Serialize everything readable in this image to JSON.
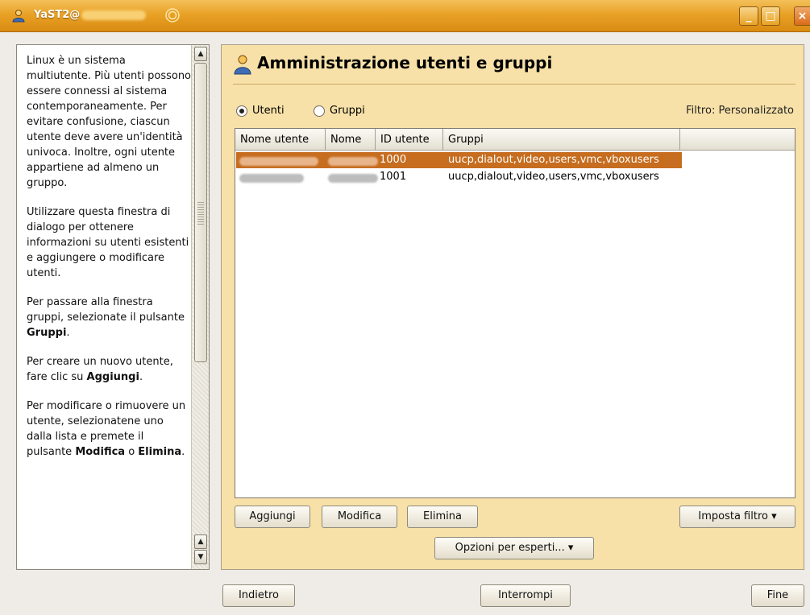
{
  "window": {
    "title": "YaST2@",
    "accent": "#e9a226",
    "minimize": "_",
    "maximize": "□",
    "close": "×"
  },
  "help": {
    "paragraphs": [
      {
        "text": "Linux è un sistema multiutente. Più utenti possono essere connessi al sistema contemporaneamente. Per evitare confusione, ciascun utente deve avere un'identità univoca. Inoltre, ogni utente appartiene ad almeno un gruppo."
      },
      {
        "text": "Utilizzare questa finestra di dialogo per ottenere informazioni su utenti esistenti e aggiungere o modificare utenti."
      },
      {
        "pre": "Per passare alla finestra gruppi, selezionate il pulsante ",
        "bold": "Gruppi",
        "post": "."
      },
      {
        "pre": "Per creare un nuovo utente, fare clic su ",
        "bold": "Aggiungi",
        "post": "."
      },
      {
        "pre": "Per modificare o rimuovere un utente, selezionatene uno dalla lista e premete il pulsante ",
        "bold": "Modifica",
        "mid": " o ",
        "bold2": "Elimina",
        "post": "."
      }
    ]
  },
  "main": {
    "title": "Amministrazione utenti e gruppi",
    "radio_users": {
      "label": "Utenti",
      "selected": true
    },
    "radio_groups": {
      "label": "Gruppi",
      "selected": false
    },
    "filter": "Filtro: Personalizzato"
  },
  "table": {
    "columns": [
      "Nome utente",
      "Nome",
      "ID utente",
      "Gruppi"
    ],
    "rows": [
      {
        "username": "",
        "name": "",
        "uid": "1000",
        "groups": "uucp,dialout,video,users,vmc,vboxusers",
        "selected": true
      },
      {
        "username": "",
        "name": "",
        "uid": "1001",
        "groups": "uucp,dialout,video,users,vmc,vboxusers",
        "selected": false
      }
    ]
  },
  "buttons": {
    "add": "Aggiungi",
    "edit": "Modifica",
    "delete": "Elimina",
    "set_filter": "Imposta filtro ▾",
    "expert": "Opzioni per esperti... ▾",
    "back": "Indietro",
    "abort": "Interrompi",
    "finish": "Fine"
  }
}
